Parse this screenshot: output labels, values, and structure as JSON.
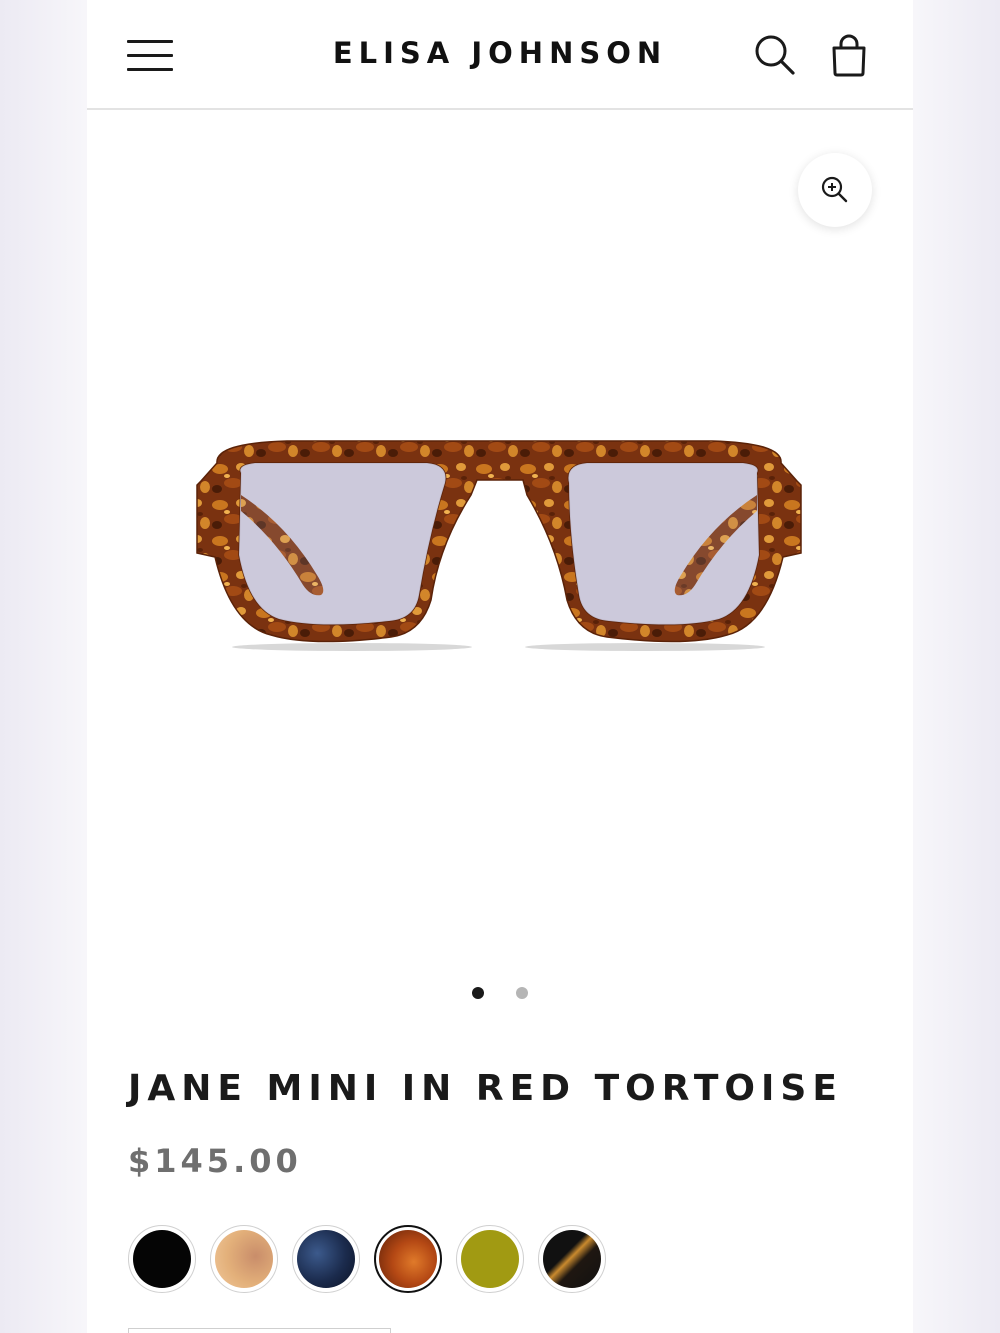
{
  "header": {
    "brand": "ELISA JOHNSON",
    "menu_icon": "hamburger-menu-icon",
    "search_icon": "search-icon",
    "cart_icon": "shopping-bag-icon"
  },
  "gallery": {
    "zoom_icon": "zoom-in-icon",
    "image_subject": "tortoise sunglasses",
    "slides_total": 2,
    "active_slide": 1
  },
  "product": {
    "title": "JANE MINI IN RED TORTOISE",
    "price": "$145.00"
  },
  "color_options": [
    {
      "color": "#050505",
      "selected": false
    },
    {
      "color": "#e3b07a",
      "selected": false
    },
    {
      "color": "#1b2b4d",
      "selected": false
    },
    {
      "color": "#b44814",
      "selected": true
    },
    {
      "color": "#a19a12",
      "selected": false
    },
    {
      "color": "#1f1711",
      "selected": false
    }
  ],
  "colors": {
    "text": "#1a1a1a",
    "price": "#6f6f6f",
    "divider": "#e3e3e3"
  }
}
